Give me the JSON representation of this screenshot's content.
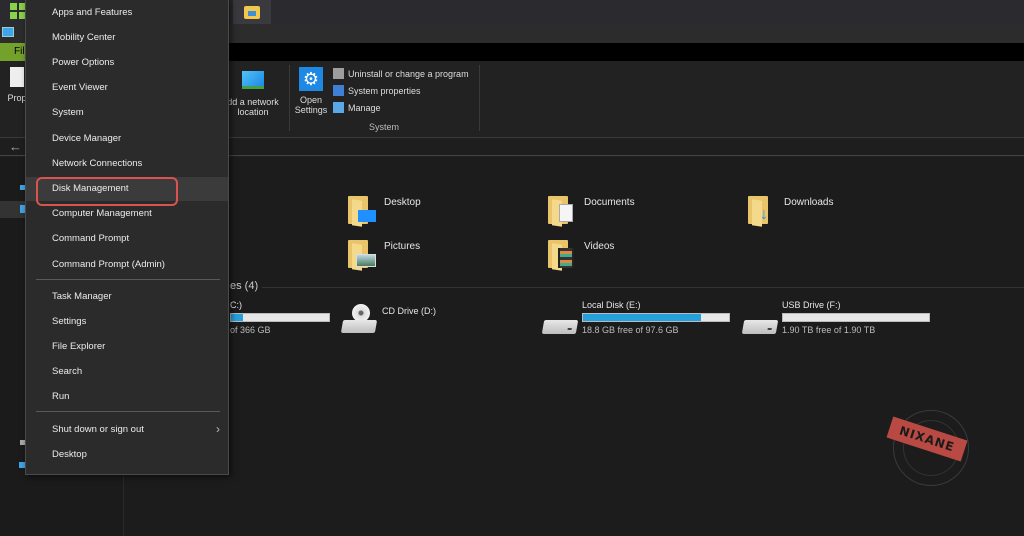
{
  "ribbon": {
    "add_network_location": "Add a network location",
    "add_network_location_visible": "dd a network",
    "add_network_location_line2": "location",
    "open_settings_line1": "Open",
    "open_settings_line2": "Settings",
    "uninstall": "Uninstall or change a program",
    "system_properties": "System properties",
    "manage": "Manage",
    "group_system": "System",
    "file_tab": "Fil",
    "properties_partial": "Prop"
  },
  "content": {
    "folders": [
      {
        "name": "Desktop",
        "icon": "desktop-folder-icon"
      },
      {
        "name": "Documents",
        "icon": "documents-folder-icon"
      },
      {
        "name": "Downloads",
        "icon": "downloads-folder-icon"
      },
      {
        "name": "Pictures",
        "icon": "pictures-folder-icon"
      },
      {
        "name": "Videos",
        "icon": "videos-folder-icon"
      }
    ],
    "devices_header": "es (4)",
    "drives": [
      {
        "name": "C:)",
        "free": "of 366 GB",
        "used_fraction": 0.12
      },
      {
        "name": "CD Drive (D:)",
        "free": "",
        "used_fraction": null
      },
      {
        "name": "Local Disk (E:)",
        "free": "18.8 GB free of 97.6 GB",
        "used_fraction": 0.81
      },
      {
        "name": "USB Drive (F:)",
        "free": "1.90 TB free of 1.90 TB",
        "used_fraction": 0.0
      }
    ]
  },
  "menu": {
    "items": [
      "Apps and Features",
      "Mobility Center",
      "Power Options",
      "Event Viewer",
      "System",
      "Device Manager",
      "Network Connections",
      "Disk Management",
      "Computer Management",
      "Command Prompt",
      "Command Prompt (Admin)",
      "Task Manager",
      "Settings",
      "File Explorer",
      "Search",
      "Run",
      "Shut down or sign out",
      "Desktop"
    ],
    "highlighted": "Disk Management"
  },
  "watermark": "NIXANE",
  "colors": {
    "accent_blue": "#26a0da",
    "highlight_red": "#d9534f",
    "file_tab_green": "#74a12b"
  }
}
